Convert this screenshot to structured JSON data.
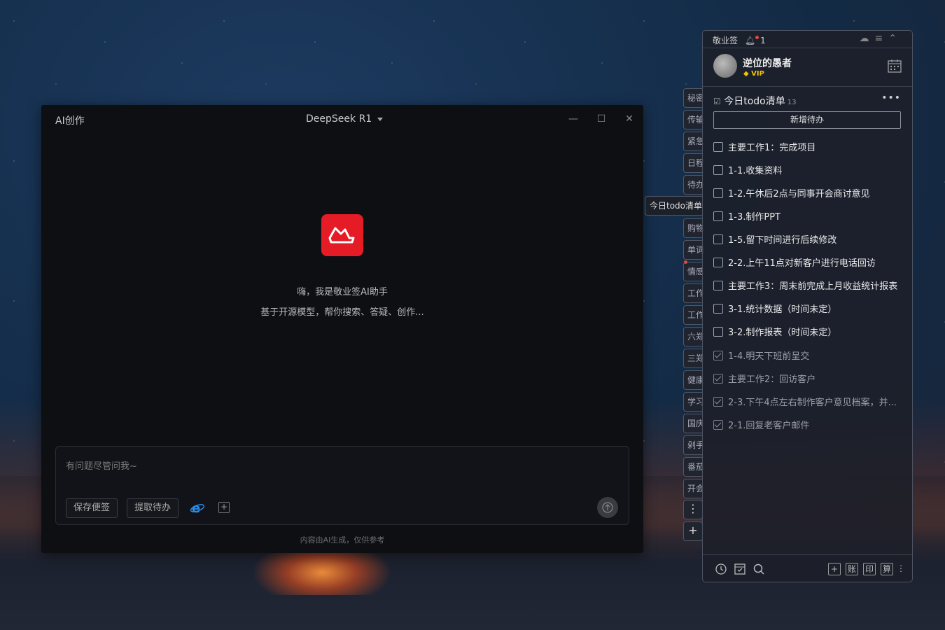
{
  "ai_window": {
    "title": "AI创作",
    "model": "DeepSeek R1",
    "controls": {
      "minimize": "—",
      "maximize": "☐",
      "close": "✕"
    },
    "greeting": "嗨，我是敬业签AI助手",
    "subtitle": "基于开源模型，帮你搜索、答疑、创作...",
    "input_placeholder": "有问题尽管问我~",
    "save_note_label": "保存便签",
    "extract_todo_label": "提取待办",
    "footer": "内容由AI生成，仅供参考",
    "colors": {
      "logo": "#e51b25",
      "background": "#0e0f13"
    }
  },
  "side_tabs": [
    "秘密",
    "传输",
    "紧急",
    "日程",
    "待办",
    "今日todo清单",
    "购物",
    "单词",
    "情感",
    "工作",
    "工作",
    "六郑",
    "三郑",
    "健康",
    "学习",
    "国庆",
    "剁手",
    "番茄",
    "开会"
  ],
  "side_buttons": {
    "more": "⋮",
    "add": "+"
  },
  "note_panel": {
    "app_name": "敬业签",
    "notification_count": "1",
    "username": "逆位的愚者",
    "vip_label": "VIP",
    "list_title": "今日todo清单",
    "list_count": "13",
    "new_todo_label": "新增待办",
    "todos": [
      {
        "text": "主要工作1：完成项目",
        "done": false
      },
      {
        "text": "1-1.收集资料",
        "done": false
      },
      {
        "text": "1-2.午休后2点与同事开会商讨意见",
        "done": false
      },
      {
        "text": "1-3.制作PPT",
        "done": false
      },
      {
        "text": "1-5.留下时间进行后续修改",
        "done": false
      },
      {
        "text": "2-2.上午11点对新客户进行电话回访",
        "done": false
      },
      {
        "text": "主要工作3：周末前完成上月收益统计报表",
        "done": false
      },
      {
        "text": "3-1.统计数据（时间未定）",
        "done": false
      },
      {
        "text": "3-2.制作报表（时间未定）",
        "done": false
      },
      {
        "text": "1-4.明天下班前呈交",
        "done": true
      },
      {
        "text": "主要工作2：回访客户",
        "done": true
      },
      {
        "text": "2-3.下午4点左右制作客户意见档案，并...",
        "done": true
      },
      {
        "text": "2-1.回复老客户邮件",
        "done": true
      }
    ],
    "bottom_bar": {
      "add": "+",
      "account": "账",
      "print": "印",
      "calc": "算"
    }
  }
}
